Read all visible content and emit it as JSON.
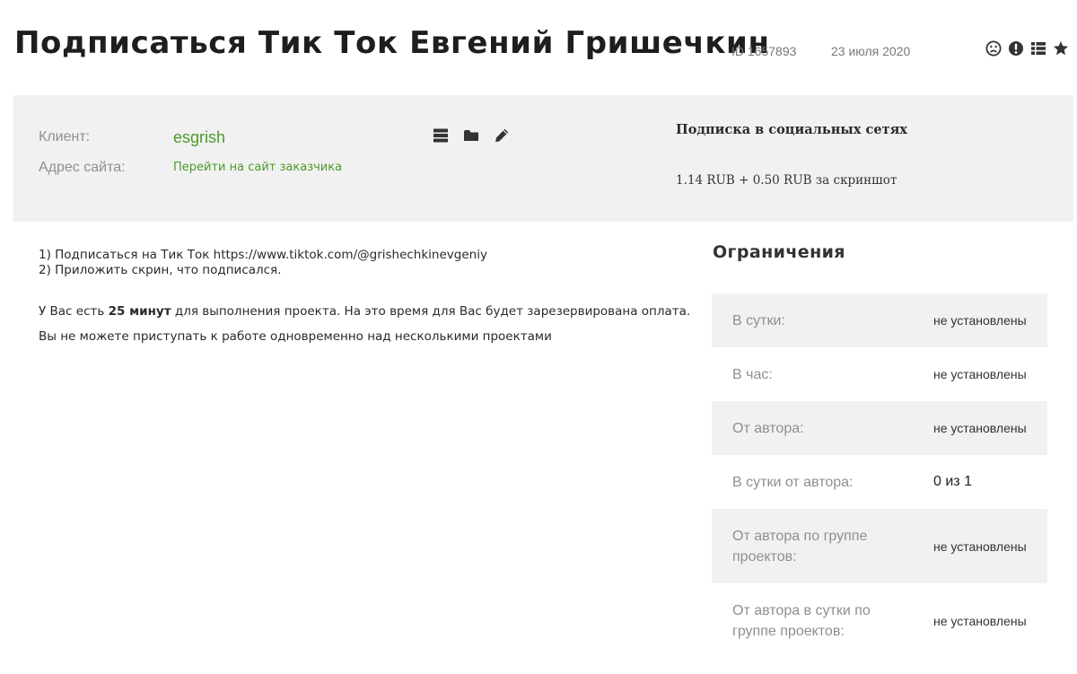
{
  "header": {
    "title": "Подписаться Тик Ток Евгений Гришечкин",
    "id_text": "ID 1657893",
    "date": "23 июля 2020",
    "icons": [
      "sad-face-icon",
      "exclamation-circle-icon",
      "list-icon",
      "star-icon"
    ]
  },
  "info": {
    "client_label": "Клиент:",
    "client_name": "esgrish",
    "site_label": "Адрес сайта:",
    "site_link": "Перейти на сайт заказчика",
    "icons": [
      "list-icon",
      "folder-icon",
      "pencil-icon"
    ],
    "subscription_title": "Подписка в социальных сетях",
    "price": "1.14 RUB + 0.50 RUB за скриншот"
  },
  "description": {
    "step1": "1) Подписаться на Тик Ток https://www.tiktok.com/@grishechkinevgeniy",
    "step2": "2) Приложить скрин, что подписался.",
    "time_prefix": "У Вас есть",
    "time_value": "25 минут",
    "time_suffix": "для выполнения проекта. На это время для Вас будет зарезервирована оплата.",
    "multi_note": "Вы не можете приступать к работе одновременно над несколькими проектами"
  },
  "limits": {
    "title": "Ограничения",
    "rows": [
      {
        "label": "В сутки:",
        "value": "не установлены"
      },
      {
        "label": "В час:",
        "value": "не установлены"
      },
      {
        "label": "От автора:",
        "value": "не установлены"
      },
      {
        "label": "В сутки от автора:",
        "value": "0 из 1"
      },
      {
        "label": "От автора по группе проектов:",
        "value": "не установлены"
      },
      {
        "label": "От автора в сутки по группе проектов:",
        "value": "не установлены"
      }
    ]
  },
  "colors": {
    "accent_green": "#4c9a2a",
    "panel_bg": "#f1f1f1",
    "muted_label": "#8f8f8f"
  }
}
